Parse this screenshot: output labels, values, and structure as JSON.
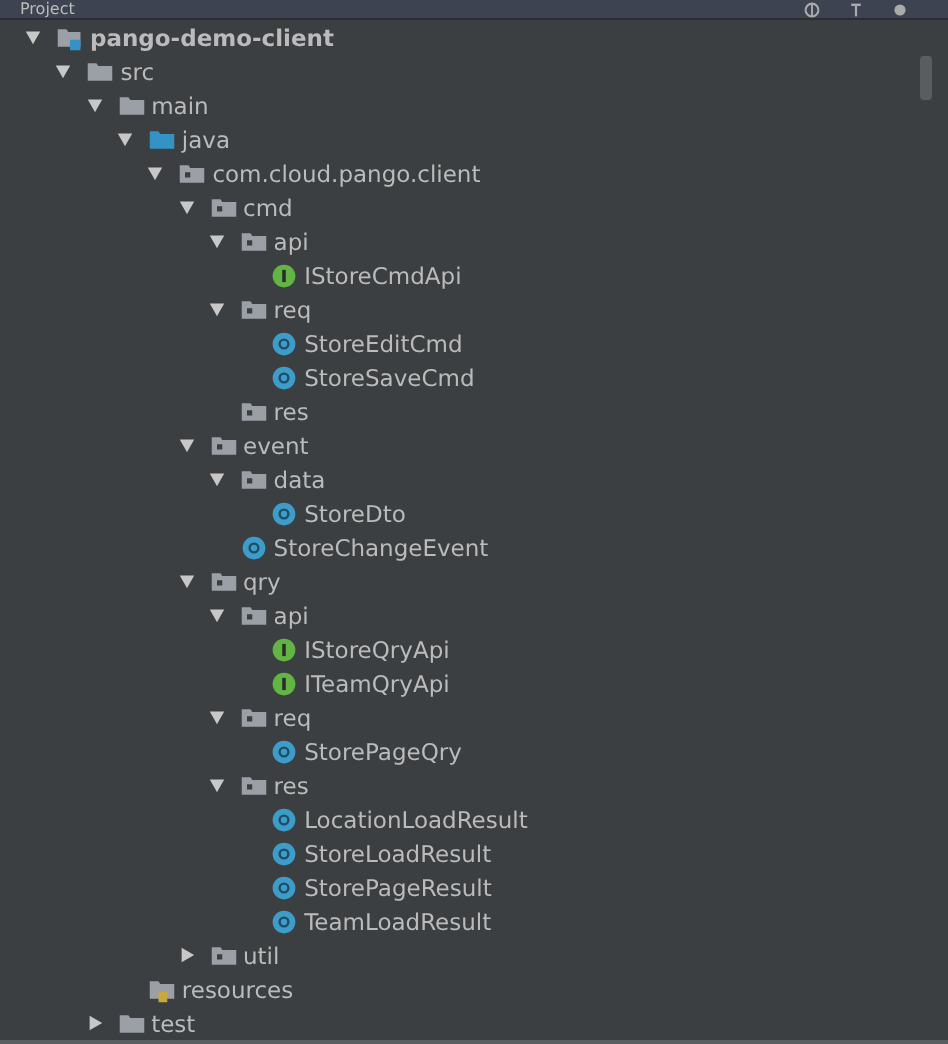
{
  "panel": {
    "title": "Project"
  },
  "tree": [
    {
      "label": "pango-demo-client",
      "kind": "module",
      "expanded": true,
      "children": [
        {
          "label": "src",
          "kind": "folder",
          "expanded": true,
          "children": [
            {
              "label": "main",
              "kind": "folder",
              "expanded": true,
              "children": [
                {
                  "label": "java",
                  "kind": "source-root",
                  "expanded": true,
                  "children": [
                    {
                      "label": "com.cloud.pango.client",
                      "kind": "package",
                      "expanded": true,
                      "children": [
                        {
                          "label": "cmd",
                          "kind": "package",
                          "expanded": true,
                          "children": [
                            {
                              "label": "api",
                              "kind": "package",
                              "expanded": true,
                              "children": [
                                {
                                  "label": "IStoreCmdApi",
                                  "kind": "interface"
                                }
                              ]
                            },
                            {
                              "label": "req",
                              "kind": "package",
                              "expanded": true,
                              "children": [
                                {
                                  "label": "StoreEditCmd",
                                  "kind": "class"
                                },
                                {
                                  "label": "StoreSaveCmd",
                                  "kind": "class"
                                }
                              ]
                            },
                            {
                              "label": "res",
                              "kind": "package"
                            }
                          ]
                        },
                        {
                          "label": "event",
                          "kind": "package",
                          "expanded": true,
                          "children": [
                            {
                              "label": "data",
                              "kind": "package",
                              "expanded": true,
                              "children": [
                                {
                                  "label": "StoreDto",
                                  "kind": "class"
                                }
                              ]
                            },
                            {
                              "label": "StoreChangeEvent",
                              "kind": "class"
                            }
                          ]
                        },
                        {
                          "label": "qry",
                          "kind": "package",
                          "expanded": true,
                          "children": [
                            {
                              "label": "api",
                              "kind": "package",
                              "expanded": true,
                              "children": [
                                {
                                  "label": "IStoreQryApi",
                                  "kind": "interface"
                                },
                                {
                                  "label": "ITeamQryApi",
                                  "kind": "interface"
                                }
                              ]
                            },
                            {
                              "label": "req",
                              "kind": "package",
                              "expanded": true,
                              "children": [
                                {
                                  "label": "StorePageQry",
                                  "kind": "class"
                                }
                              ]
                            },
                            {
                              "label": "res",
                              "kind": "package",
                              "expanded": true,
                              "children": [
                                {
                                  "label": "LocationLoadResult",
                                  "kind": "class"
                                },
                                {
                                  "label": "StoreLoadResult",
                                  "kind": "class"
                                },
                                {
                                  "label": "StorePageResult",
                                  "kind": "class"
                                },
                                {
                                  "label": "TeamLoadResult",
                                  "kind": "class"
                                }
                              ]
                            }
                          ]
                        },
                        {
                          "label": "util",
                          "kind": "package",
                          "expanded": false
                        }
                      ]
                    }
                  ]
                },
                {
                  "label": "resources",
                  "kind": "resources"
                }
              ]
            },
            {
              "label": "test",
              "kind": "folder",
              "expanded": false
            }
          ]
        }
      ]
    }
  ]
}
